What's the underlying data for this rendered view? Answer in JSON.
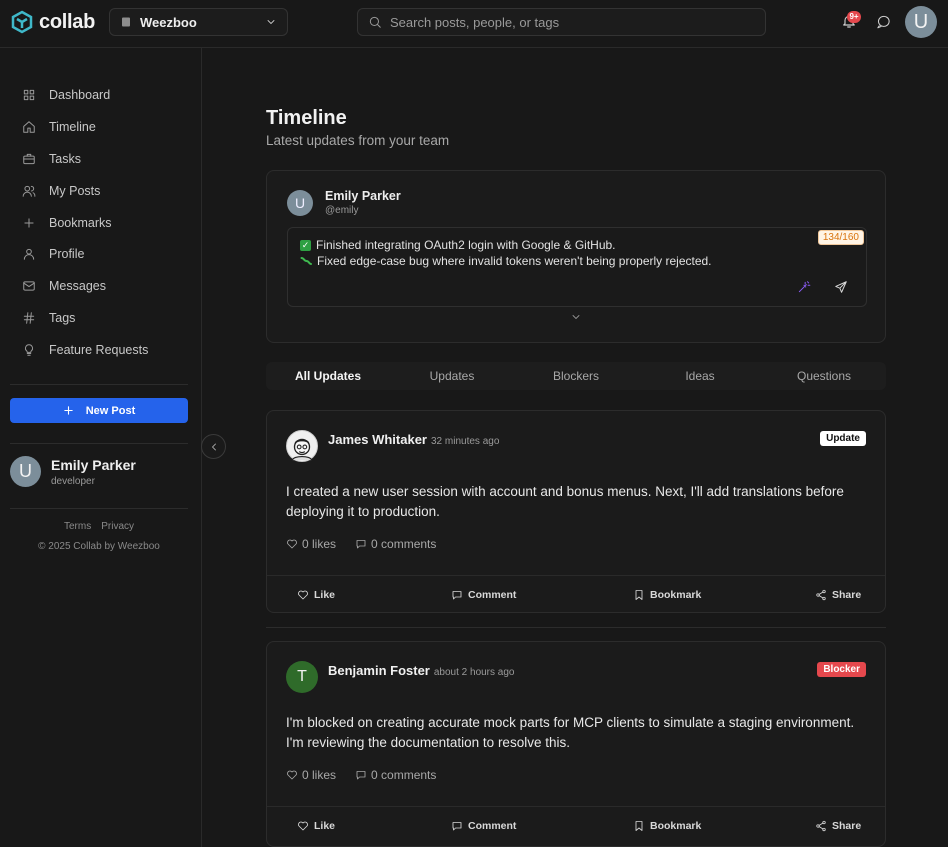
{
  "app": {
    "name": "collab"
  },
  "workspace": {
    "name": "Weezboo"
  },
  "search": {
    "placeholder": "Search posts, people, or tags"
  },
  "notifications": {
    "badge": "9+"
  },
  "current_user": {
    "initial": "U",
    "name": "Emily Parker",
    "role": "developer",
    "handle": "@emily"
  },
  "sidebar": {
    "items": [
      {
        "label": "Dashboard",
        "icon": "grid-icon"
      },
      {
        "label": "Timeline",
        "icon": "home-icon"
      },
      {
        "label": "Tasks",
        "icon": "briefcase-icon"
      },
      {
        "label": "My Posts",
        "icon": "users-icon"
      },
      {
        "label": "Bookmarks",
        "icon": "plus-icon"
      },
      {
        "label": "Profile",
        "icon": "user-icon"
      },
      {
        "label": "Messages",
        "icon": "mail-icon"
      },
      {
        "label": "Tags",
        "icon": "hash-icon"
      },
      {
        "label": "Feature Requests",
        "icon": "lightbulb-icon"
      }
    ],
    "new_post_label": "New Post",
    "links": [
      "Terms",
      "Privacy"
    ],
    "copyright": "© 2025 Collab by Weezboo"
  },
  "page": {
    "title": "Timeline",
    "subtitle": "Latest updates from your team"
  },
  "composer": {
    "lines": [
      "Finished integrating OAuth2 login with Google & GitHub.",
      "Fixed edge-case bug where invalid tokens weren't being properly rejected."
    ],
    "counter": "134/160"
  },
  "tabs": [
    "All Updates",
    "Updates",
    "Blockers",
    "Ideas",
    "Questions"
  ],
  "posts": [
    {
      "author": "James Whitaker",
      "time": "32 minutes ago",
      "tag": "Update",
      "tag_color": "#ffffff",
      "body": "I created a new user session with account and bonus menus. Next, I'll add translations before deploying it to production.",
      "likes": "0 likes",
      "comments": "0 comments"
    },
    {
      "author": "Benjamin Foster",
      "initial": "T",
      "time": "about 2 hours ago",
      "tag": "Blocker",
      "tag_color": "#e5484d",
      "body": "I'm blocked on creating accurate mock parts for MCP clients to simulate a staging environment. I'm reviewing the documentation to resolve this.",
      "likes": "0 likes",
      "comments": "0 comments"
    }
  ],
  "post_actions": {
    "like": "Like",
    "comment": "Comment",
    "bookmark": "Bookmark",
    "share": "Share"
  }
}
